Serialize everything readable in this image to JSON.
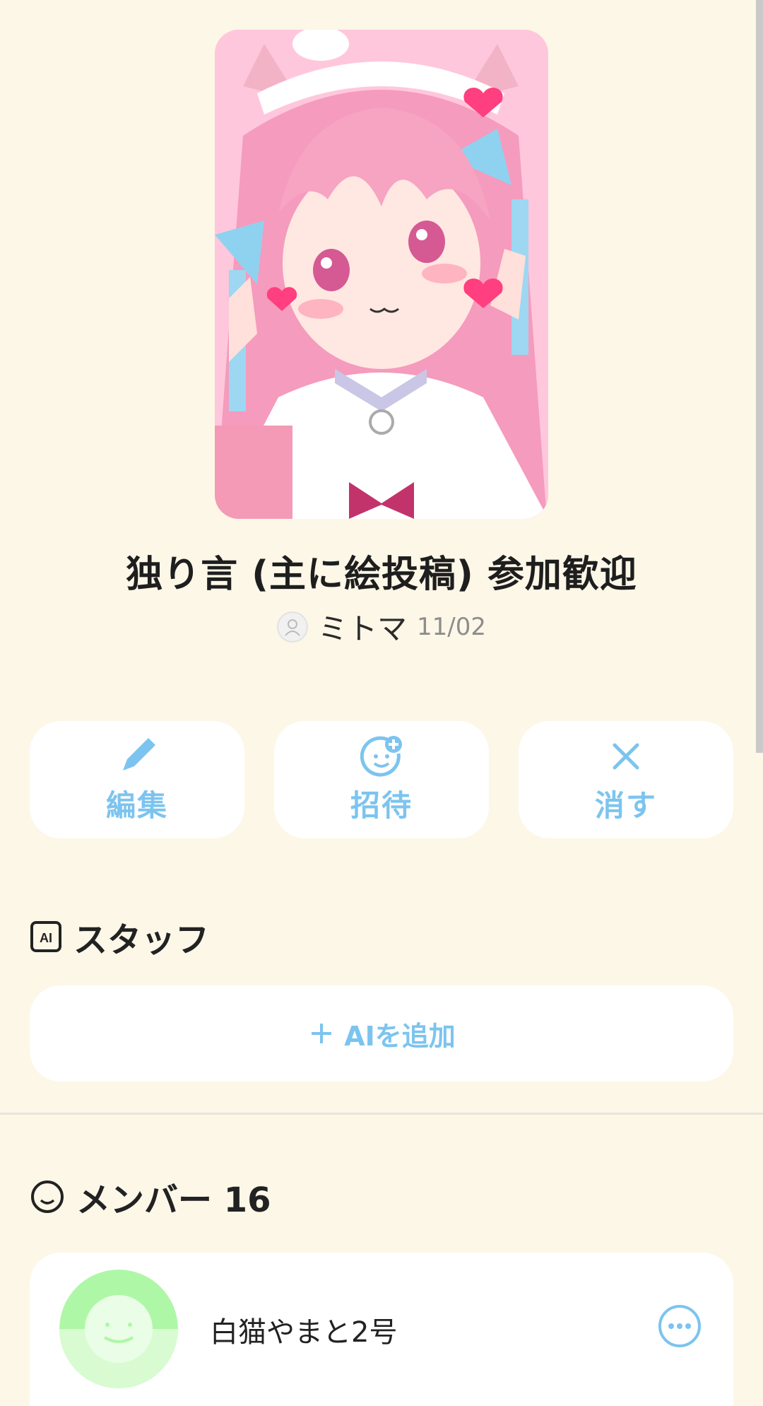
{
  "post": {
    "title": "独り言 (主に絵投稿) 参加歓迎",
    "author": "ミトマ",
    "date": "11/02"
  },
  "actions": [
    {
      "label": "編集",
      "icon": "pencil-icon"
    },
    {
      "label": "招待",
      "icon": "add-person-icon"
    },
    {
      "label": "消す",
      "icon": "close-icon"
    }
  ],
  "staff": {
    "heading": "スタッフ",
    "badge": "AI",
    "add_label": "AIを追加"
  },
  "members": {
    "heading": "メンバー 16",
    "list": [
      {
        "name": "白猫やまと2号"
      }
    ]
  },
  "colors": {
    "background": "#fdf7e8",
    "accent": "#7cc4ef",
    "card": "#ffffff"
  }
}
